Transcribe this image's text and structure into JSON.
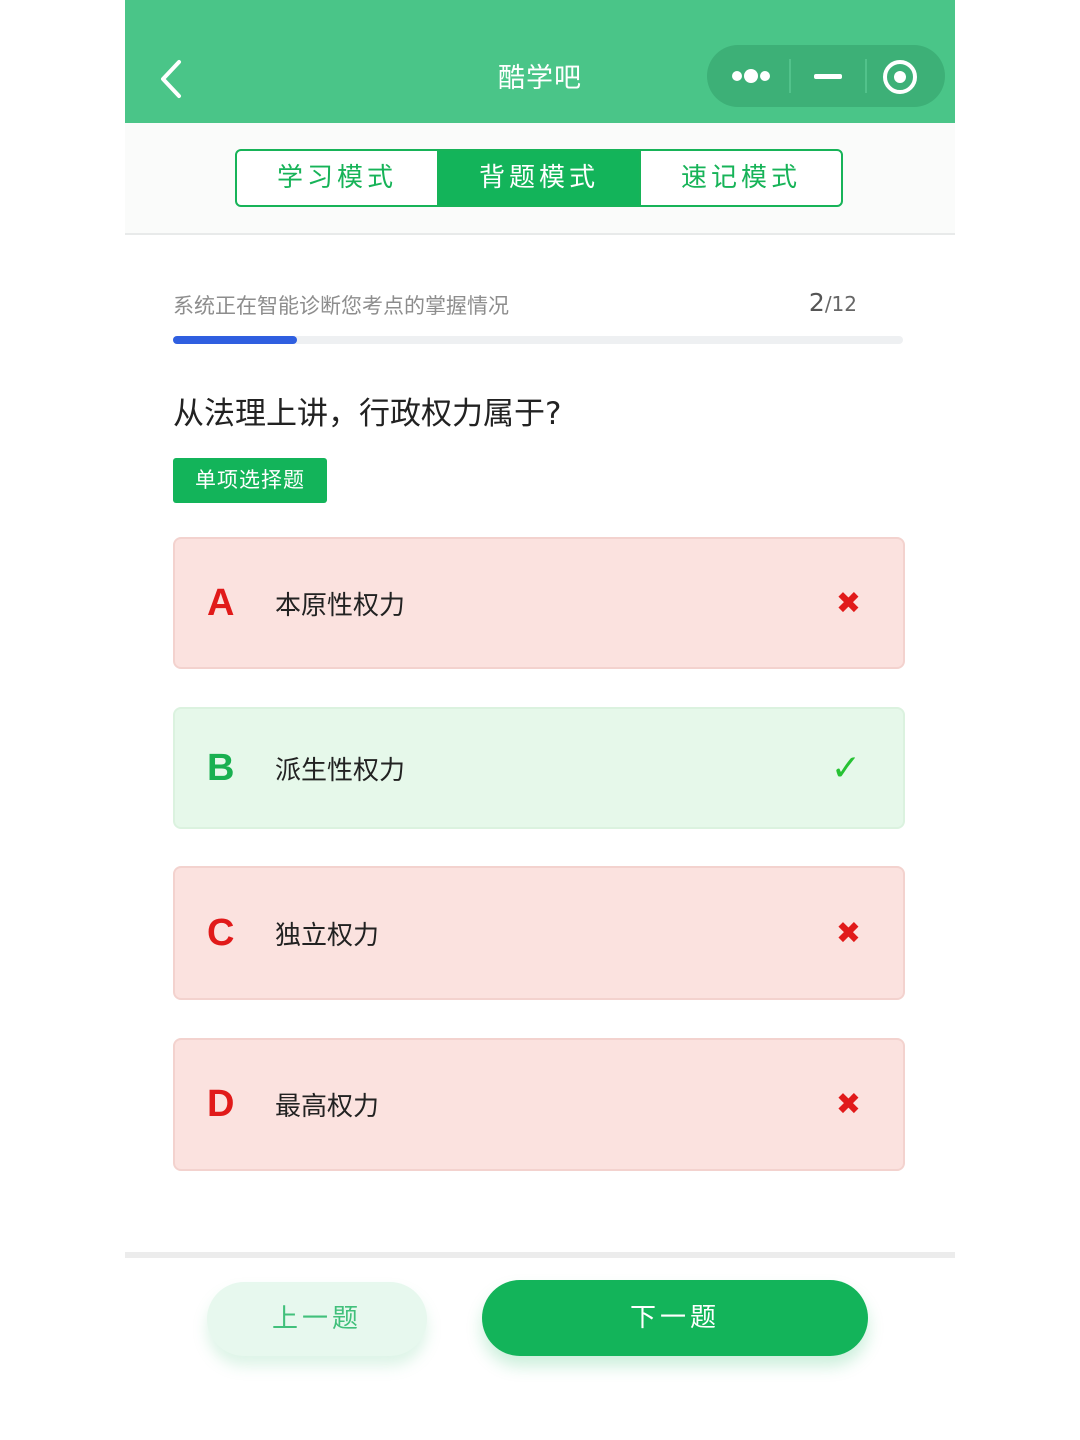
{
  "header": {
    "title": "酷学吧",
    "back_icon": "chevron-left-icon",
    "capsule_icons": [
      "more-dots-icon",
      "minimize-icon",
      "close-target-icon"
    ]
  },
  "tabs": [
    {
      "label": "学习模式",
      "active": false
    },
    {
      "label": "背题模式",
      "active": true
    },
    {
      "label": "速记模式",
      "active": false
    }
  ],
  "progress": {
    "text": "系统正在智能诊断您考点的掌握情况",
    "current": "2",
    "total": "/12",
    "fraction": 0.17
  },
  "question": {
    "text": "从法理上讲，行政权力属于?",
    "type_label": "单项选择题"
  },
  "options": [
    {
      "letter": "A",
      "text": "本原性权力",
      "status": "wrong",
      "mark": "✖"
    },
    {
      "letter": "B",
      "text": "派生性权力",
      "status": "right",
      "mark": "✓"
    },
    {
      "letter": "C",
      "text": "独立权力",
      "status": "wrong",
      "mark": "✖"
    },
    {
      "letter": "D",
      "text": "最高权力",
      "status": "wrong",
      "mark": "✖"
    }
  ],
  "footer": {
    "prev_label": "上一题",
    "next_label": "下一题"
  },
  "colors": {
    "header_green": "#4ac588",
    "primary_green": "#13b45a",
    "wrong_red": "#e11a1a",
    "progress_blue": "#2f5fe0"
  }
}
